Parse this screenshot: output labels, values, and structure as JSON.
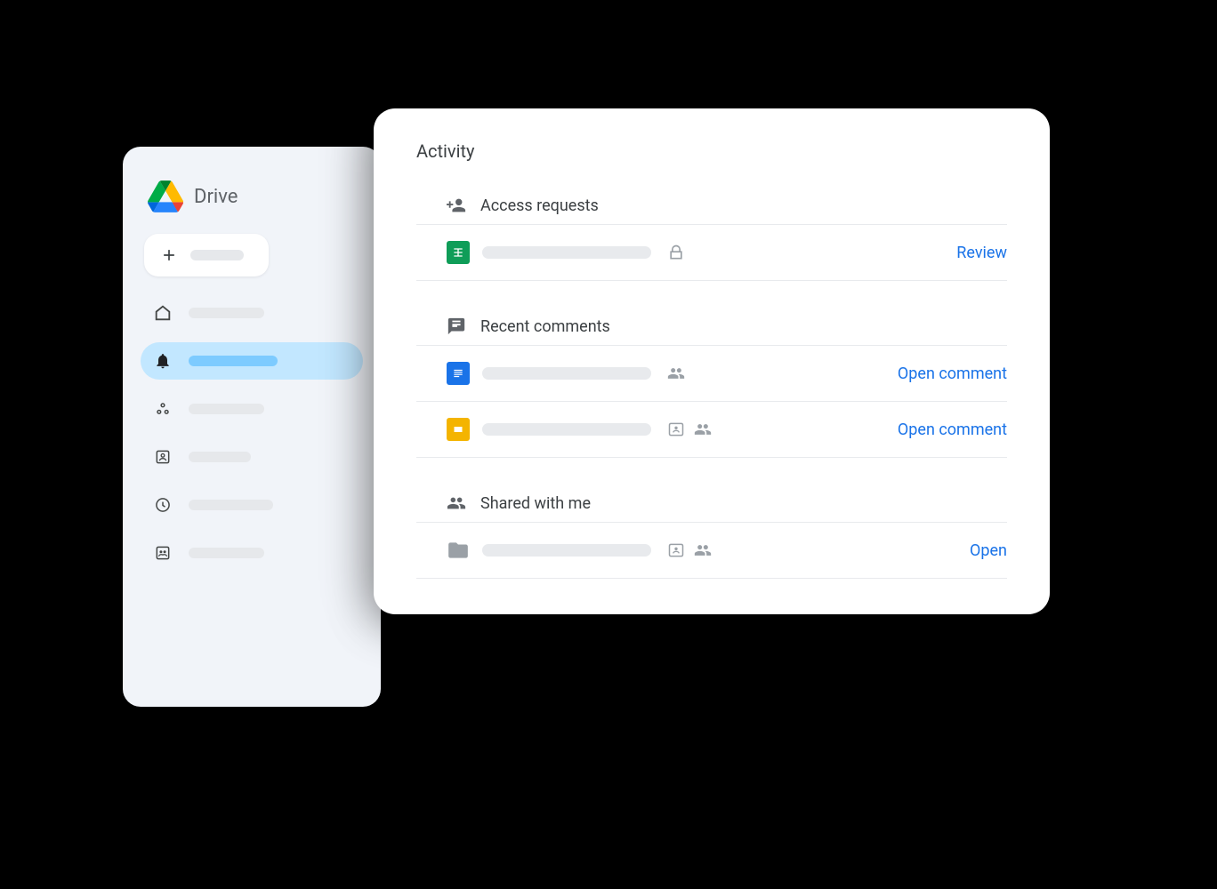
{
  "sidebar": {
    "title": "Drive"
  },
  "panel": {
    "title": "Activity",
    "sections": {
      "access": {
        "title": "Access requests",
        "row_action": "Review"
      },
      "comments": {
        "title": "Recent comments",
        "row1_action": "Open comment",
        "row2_action": "Open comment"
      },
      "shared": {
        "title": "Shared with me",
        "row_action": "Open"
      }
    }
  }
}
